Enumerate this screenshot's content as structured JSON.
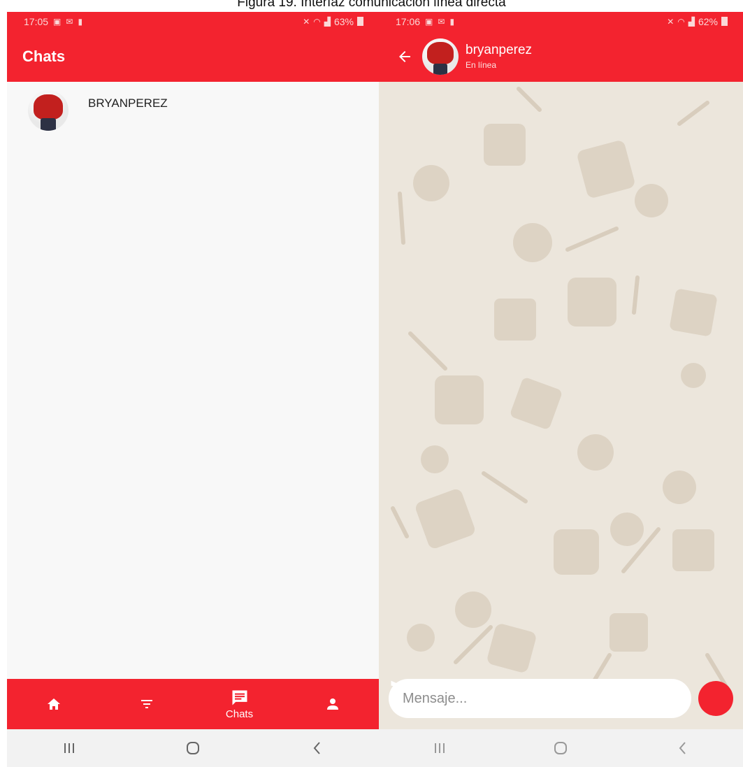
{
  "caption": "Figura 19. Interfaz comunicación línea directa",
  "left_screen": {
    "status_bar": {
      "time": "17:05",
      "battery": "63%"
    },
    "app_bar": {
      "title": "Chats"
    },
    "chats": [
      {
        "name": "BRYANPEREZ"
      }
    ],
    "bottom_nav": {
      "chats_label": "Chats"
    }
  },
  "right_screen": {
    "status_bar": {
      "time": "17:06",
      "battery": "62%"
    },
    "contact": {
      "name": "bryanperez",
      "status": "En línea"
    },
    "composer": {
      "placeholder": "Mensaje..."
    }
  },
  "colors": {
    "primary": "#f3232f",
    "chat_background": "#ece6dc",
    "list_background": "#f8f8f8"
  },
  "icons": [
    "gallery-icon",
    "mail-icon",
    "notification-icon",
    "mute-icon",
    "wifi-icon",
    "signal-icon",
    "battery-icon",
    "back-arrow-icon",
    "home-icon",
    "filter-icon",
    "chat-icon",
    "person-icon",
    "send-icon",
    "recents-icon",
    "home-circle-icon",
    "back-chevron-icon"
  ]
}
